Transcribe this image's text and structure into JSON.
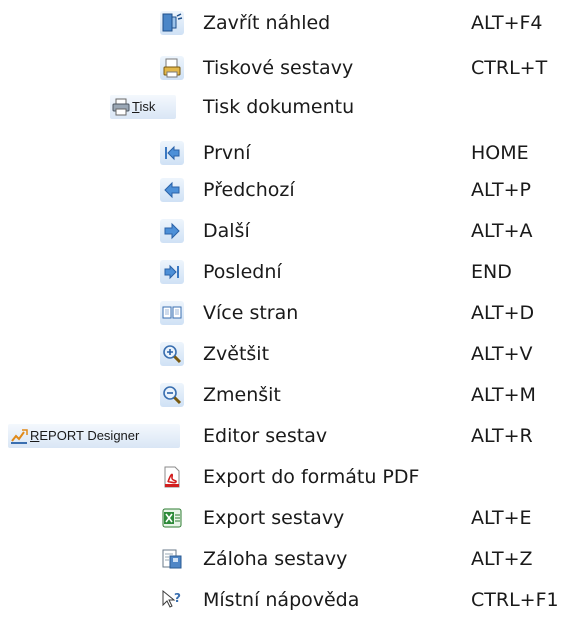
{
  "shortcuts": [
    {
      "label": "Zavřít náhled",
      "key": "ALT+F4",
      "icon": "close-preview-icon"
    },
    {
      "label": "Tiskové sestavy",
      "key": "CTRL+T",
      "icon": "print-reports-icon"
    },
    {
      "label": "Tisk dokumentu",
      "key": "",
      "icon": "print-icon",
      "button_label": "Tisk"
    },
    {
      "label": "První",
      "key": "HOME",
      "icon": "first-page-icon"
    },
    {
      "label": "Předchozí",
      "key": "ALT+P",
      "icon": "previous-page-icon"
    },
    {
      "label": "Další",
      "key": "ALT+A",
      "icon": "next-page-icon"
    },
    {
      "label": "Poslední",
      "key": "END",
      "icon": "last-page-icon"
    },
    {
      "label": "Více stran",
      "key": "ALT+D",
      "icon": "multiple-pages-icon"
    },
    {
      "label": "Zvětšit",
      "key": "ALT+V",
      "icon": "zoom-in-icon"
    },
    {
      "label": "Zmenšit",
      "key": "ALT+M",
      "icon": "zoom-out-icon"
    },
    {
      "label": "Editor sestav",
      "key": "ALT+R",
      "icon": "report-designer-icon",
      "button_label": "REPORT Designer"
    },
    {
      "label": "Export do formátu PDF",
      "key": "",
      "icon": "pdf-export-icon"
    },
    {
      "label": "Export sestavy",
      "key": "ALT+E",
      "icon": "excel-export-icon"
    },
    {
      "label": "Záloha sestavy",
      "key": "ALT+Z",
      "icon": "backup-report-icon"
    },
    {
      "label": "Místní nápověda",
      "key": "CTRL+F1",
      "icon": "context-help-icon"
    }
  ]
}
